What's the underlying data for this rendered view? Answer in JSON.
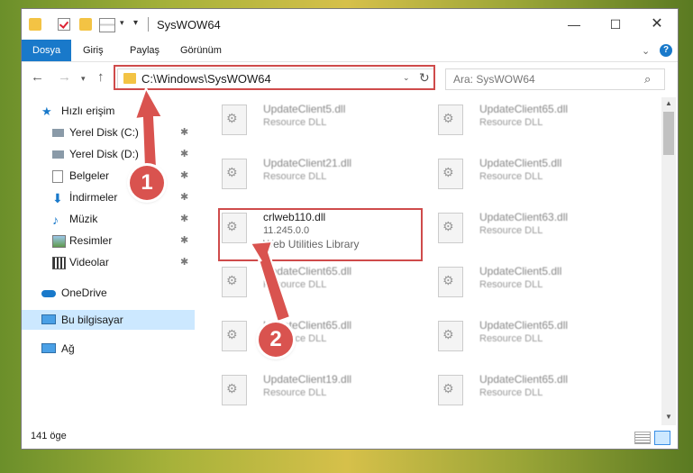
{
  "window": {
    "title": "SysWOW64",
    "controls": {
      "minimize": "—",
      "maximize": "☐",
      "close": "✕"
    }
  },
  "ribbon": {
    "tabs": [
      "Dosya",
      "Giriş",
      "Paylaş",
      "Görünüm"
    ],
    "help": "?"
  },
  "navigation": {
    "address": "C:\\Windows\\SysWOW64",
    "search_placeholder": "Ara: SysWOW64"
  },
  "sidebar": {
    "items": [
      {
        "label": "Hızlı erişim",
        "icon": "star-icon",
        "pinned": false
      },
      {
        "label": "Yerel Disk (C:)",
        "icon": "drive-icon",
        "pinned": true
      },
      {
        "label": "Yerel Disk (D:)",
        "icon": "drive-icon",
        "pinned": true
      },
      {
        "label": "Belgeler",
        "icon": "document-icon",
        "pinned": true
      },
      {
        "label": "İndirmeler",
        "icon": "download-icon",
        "pinned": true
      },
      {
        "label": "Müzik",
        "icon": "music-icon",
        "pinned": true
      },
      {
        "label": "Resimler",
        "icon": "pictures-icon",
        "pinned": true
      },
      {
        "label": "Videolar",
        "icon": "video-icon",
        "pinned": true
      },
      {
        "label": "OneDrive",
        "icon": "cloud-icon",
        "pinned": false
      },
      {
        "label": "Bu bilgisayar",
        "icon": "computer-icon",
        "pinned": false,
        "selected": true
      },
      {
        "label": "Ağ",
        "icon": "network-icon",
        "pinned": false
      }
    ],
    "pin_glyph": "📌"
  },
  "files": [
    {
      "name": "UpdateClient5.dll",
      "type": "Resource DLL"
    },
    {
      "name": "UpdateClient65.dll",
      "type": "Resource DLL"
    },
    {
      "name": "UpdateClient21.dll",
      "type": "Resource DLL"
    },
    {
      "name": "UpdateClient5.dll",
      "type": "Resource DLL"
    },
    {
      "name": "crlweb110.dll",
      "type": "11.245.0.0",
      "description": "Web Utilities Library",
      "highlighted": true
    },
    {
      "name": "UpdateClient63.dll",
      "type": "Resource DLL"
    },
    {
      "name": "UpdateClient65.dll",
      "type": "Resource DLL"
    },
    {
      "name": "UpdateClient5.dll",
      "type": "Resource DLL"
    },
    {
      "name": "UpdateClient65.dll",
      "type": "Resource DLL"
    },
    {
      "name": "UpdateClient65.dll",
      "type": "Resource DLL"
    },
    {
      "name": "UpdateClient19.dll",
      "type": "Resource DLL"
    },
    {
      "name": "UpdateClient65.dll",
      "type": "Resource DLL"
    }
  ],
  "status": {
    "item_count": "141 öge"
  },
  "annotations": {
    "step1": "1",
    "step2": "2",
    "color": "#d9534f"
  }
}
